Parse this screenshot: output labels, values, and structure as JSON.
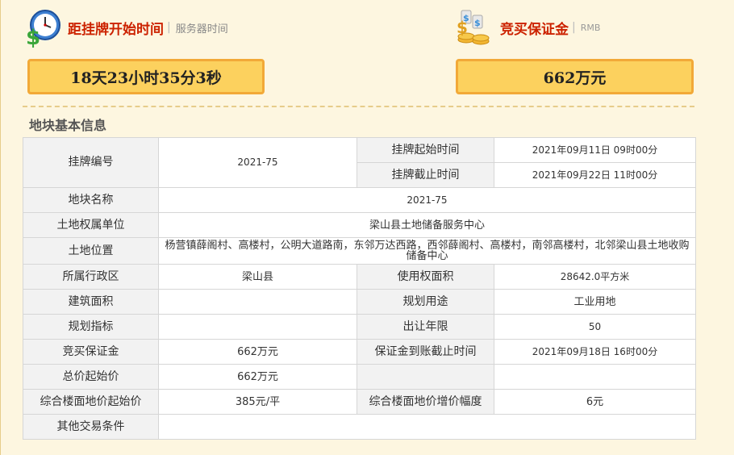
{
  "header": {
    "countdown": {
      "title": "距挂牌开始时间",
      "sub": "服务器时间",
      "value": "18天23小时35分3秒"
    },
    "deposit": {
      "title": "竞买保证金",
      "sub": "RMB",
      "value": "662万元"
    }
  },
  "section_title": "地块基本信息",
  "table": {
    "listing_no_label": "挂牌编号",
    "listing_no": "2021-75",
    "start_label": "挂牌起始时间",
    "start_time": "2021年09月11日 09时00分",
    "end_label": "挂牌截止时间",
    "end_time": "2021年09月22日 11时00分",
    "parcel_name_label": "地块名称",
    "parcel_name": "2021-75",
    "owner_label": "土地权属单位",
    "owner": "梁山县土地储备服务中心",
    "location_label": "土地位置",
    "location": "杨营镇薛阁村、高楼村，公明大道路南，东邻万达西路，西邻薛阁村、高楼村，南邻高楼村，北邻梁山县土地收购储备中心",
    "district_label": "所属行政区",
    "district": "梁山县",
    "area_label": "使用权面积",
    "area": "28642.0平方米",
    "building_area_label": "建筑面积",
    "building_area": "",
    "usage_label": "规划用途",
    "usage": "工业用地",
    "plan_index_label": "规划指标",
    "plan_index": "",
    "term_label": "出让年限",
    "term": "50",
    "deposit_label": "竞买保证金",
    "deposit": "662万元",
    "deposit_deadline_label": "保证金到账截止时间",
    "deposit_deadline": "2021年09月18日 16时00分",
    "start_price_label": "总价起始价",
    "start_price": "662万元",
    "floor_price_label": "综合楼面地价起始价",
    "floor_price": "385元/平",
    "increment_label": "综合楼面地价增价幅度",
    "increment": "6元",
    "other_label": "其他交易条件",
    "other": ""
  },
  "icons": {
    "clock": "clock-money-icon",
    "coins": "coins-money-icon"
  },
  "colors": {
    "accent_red": "#cc2200",
    "box_fill": "#fcd15e",
    "box_border": "#f2a938",
    "background": "#fdf6e0"
  }
}
